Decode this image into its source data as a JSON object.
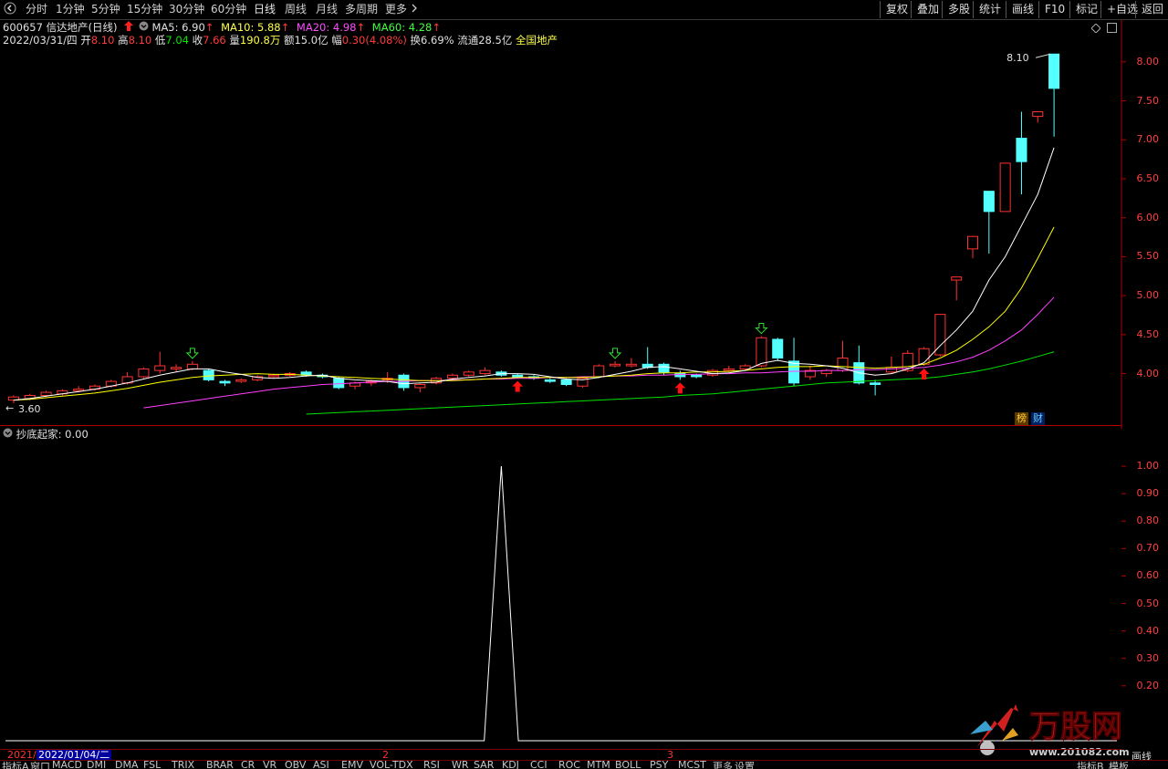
{
  "toolbar": {
    "back_icon": "chevron-left-icon",
    "periods": [
      "分时",
      "1分钟",
      "5分钟",
      "15分钟",
      "30分钟",
      "60分钟",
      "日线",
      "周线",
      "月线",
      "多周期",
      "更多"
    ],
    "active_period": "日线",
    "more_icon": "chevron-right-icon",
    "right_buttons": [
      "复权",
      "叠加",
      "多股",
      "统计",
      "画线",
      "F10",
      "标记",
      "+自选",
      "返回"
    ]
  },
  "stock": {
    "code": "600657",
    "name": "信达地产",
    "period": "(日线)",
    "ma5_label": "MA5: 6.90",
    "ma10_label": "MA10: 5.88",
    "ma20_label": "MA20: 4.98",
    "ma60_label": "MA60: 4.28",
    "arrow": "↑"
  },
  "quote": {
    "date": "2022/03/31/四",
    "open_lbl": "开",
    "open": "8.10",
    "high_lbl": "高",
    "high": "8.10",
    "low_lbl": "低",
    "low": "7.04",
    "close_lbl": "收",
    "close": "7.66",
    "vol_lbl": "量",
    "vol": "190.8万",
    "amount_lbl": "额",
    "amount": "15.0亿",
    "change_lbl": "幅",
    "change": "0.30(4.08%)",
    "turnover_lbl": "换",
    "turnover": "6.69%",
    "float_lbl": "流通",
    "float": "28.5亿",
    "sector": "全国地产"
  },
  "price_axis": [
    "8.00",
    "7.50",
    "7.00",
    "6.50",
    "6.00",
    "5.50",
    "5.00",
    "4.50",
    "4.00"
  ],
  "price_axis_values": [
    8.0,
    7.5,
    7.0,
    6.5,
    6.0,
    5.5,
    5.0,
    4.5,
    4.0
  ],
  "high_marker": "8.10",
  "low_marker": "3.60",
  "badges": {
    "bang": "榜",
    "cai": "财"
  },
  "indicator": {
    "name": "抄底起家",
    "value": ": 0.00",
    "axis": [
      "1.00",
      "0.90",
      "0.80",
      "0.70",
      "0.60",
      "0.50",
      "0.40",
      "0.30",
      "0.20"
    ]
  },
  "dates": {
    "start": "2021/",
    "selected": "2022/01/04/二",
    "m2": "2",
    "m3": "3"
  },
  "bottom_tabs": [
    "指标A",
    "窗口",
    "MACD",
    "DMI",
    "DMA",
    "FSL",
    "TRIX",
    "BRAR",
    "CR",
    "VR",
    "OBV",
    "ASI",
    "EMV",
    "VOL-TDX",
    "RSI",
    "WR",
    "SAR",
    "KDJ",
    "CCI",
    "ROC",
    "MTM",
    "BOLL",
    "PSY",
    "MCST",
    "更多",
    "设置"
  ],
  "bottom_right": [
    "指标B",
    "模板"
  ],
  "corner_label": "画线",
  "watermark": {
    "brand": "万股网",
    "url": "www.201082.com"
  },
  "colors": {
    "up": "#ff3232",
    "down": "#54ffff",
    "ma5": "#ffffff",
    "ma10": "#ffff00",
    "ma20": "#ff40ff",
    "ma60": "#00e000",
    "axis": "#b00000"
  },
  "chart_data": {
    "type": "candlestick",
    "candles": [
      {
        "o": 3.66,
        "c": 3.7,
        "h": 3.72,
        "l": 3.62
      },
      {
        "o": 3.68,
        "c": 3.72,
        "h": 3.74,
        "l": 3.66
      },
      {
        "o": 3.72,
        "c": 3.76,
        "h": 3.78,
        "l": 3.7
      },
      {
        "o": 3.74,
        "c": 3.78,
        "h": 3.8,
        "l": 3.72
      },
      {
        "o": 3.78,
        "c": 3.8,
        "h": 3.84,
        "l": 3.76
      },
      {
        "o": 3.8,
        "c": 3.84,
        "h": 3.86,
        "l": 3.78
      },
      {
        "o": 3.84,
        "c": 3.9,
        "h": 3.92,
        "l": 3.82
      },
      {
        "o": 3.88,
        "c": 3.96,
        "h": 4.02,
        "l": 3.86
      },
      {
        "o": 3.96,
        "c": 4.06,
        "h": 4.08,
        "l": 3.94
      },
      {
        "o": 4.04,
        "c": 4.1,
        "h": 4.28,
        "l": 4.0
      },
      {
        "o": 4.06,
        "c": 4.08,
        "h": 4.12,
        "l": 4.02
      },
      {
        "o": 4.06,
        "c": 4.12,
        "h": 4.16,
        "l": 4.04
      },
      {
        "o": 4.04,
        "c": 3.92,
        "h": 4.06,
        "l": 3.9
      },
      {
        "o": 3.9,
        "c": 3.88,
        "h": 3.92,
        "l": 3.84
      },
      {
        "o": 3.9,
        "c": 3.92,
        "h": 3.94,
        "l": 3.88
      },
      {
        "o": 3.92,
        "c": 3.96,
        "h": 3.98,
        "l": 3.9
      },
      {
        "o": 3.96,
        "c": 3.98,
        "h": 4.0,
        "l": 3.94
      },
      {
        "o": 3.98,
        "c": 4.0,
        "h": 4.02,
        "l": 3.96
      },
      {
        "o": 4.02,
        "c": 3.98,
        "h": 4.04,
        "l": 3.96
      },
      {
        "o": 3.98,
        "c": 3.96,
        "h": 4.0,
        "l": 3.94
      },
      {
        "o": 3.94,
        "c": 3.82,
        "h": 3.96,
        "l": 3.8
      },
      {
        "o": 3.84,
        "c": 3.88,
        "h": 3.9,
        "l": 3.8
      },
      {
        "o": 3.88,
        "c": 3.9,
        "h": 3.92,
        "l": 3.84
      },
      {
        "o": 3.92,
        "c": 3.94,
        "h": 4.02,
        "l": 3.88
      },
      {
        "o": 3.98,
        "c": 3.82,
        "h": 4.0,
        "l": 3.78
      },
      {
        "o": 3.82,
        "c": 3.86,
        "h": 3.88,
        "l": 3.76
      },
      {
        "o": 3.88,
        "c": 3.94,
        "h": 3.96,
        "l": 3.86
      },
      {
        "o": 3.94,
        "c": 3.98,
        "h": 4.0,
        "l": 3.92
      },
      {
        "o": 3.98,
        "c": 4.02,
        "h": 4.04,
        "l": 3.96
      },
      {
        "o": 4.0,
        "c": 4.04,
        "h": 4.08,
        "l": 3.98
      },
      {
        "o": 4.02,
        "c": 3.98,
        "h": 4.04,
        "l": 3.96
      },
      {
        "o": 3.98,
        "c": 3.96,
        "h": 4.0,
        "l": 3.94
      },
      {
        "o": 3.96,
        "c": 3.94,
        "h": 3.98,
        "l": 3.92
      },
      {
        "o": 3.92,
        "c": 3.9,
        "h": 3.94,
        "l": 3.88
      },
      {
        "o": 3.92,
        "c": 3.86,
        "h": 3.94,
        "l": 3.84
      },
      {
        "o": 3.84,
        "c": 3.94,
        "h": 3.96,
        "l": 3.82
      },
      {
        "o": 3.96,
        "c": 4.1,
        "h": 4.12,
        "l": 3.94
      },
      {
        "o": 4.1,
        "c": 4.12,
        "h": 4.16,
        "l": 4.08
      },
      {
        "o": 4.1,
        "c": 4.12,
        "h": 4.2,
        "l": 4.08
      },
      {
        "o": 4.12,
        "c": 4.08,
        "h": 4.34,
        "l": 4.06
      },
      {
        "o": 4.12,
        "c": 4.02,
        "h": 4.14,
        "l": 3.98
      },
      {
        "o": 4.0,
        "c": 3.96,
        "h": 4.04,
        "l": 3.92
      },
      {
        "o": 3.98,
        "c": 3.96,
        "h": 4.0,
        "l": 3.94
      },
      {
        "o": 3.98,
        "c": 4.04,
        "h": 4.06,
        "l": 3.96
      },
      {
        "o": 4.04,
        "c": 4.06,
        "h": 4.1,
        "l": 4.02
      },
      {
        "o": 4.06,
        "c": 4.1,
        "h": 4.12,
        "l": 4.04
      },
      {
        "o": 4.1,
        "c": 4.46,
        "h": 4.48,
        "l": 4.08
      },
      {
        "o": 4.44,
        "c": 4.2,
        "h": 4.46,
        "l": 4.16
      },
      {
        "o": 4.16,
        "c": 3.88,
        "h": 4.46,
        "l": 3.84
      },
      {
        "o": 3.96,
        "c": 4.04,
        "h": 4.1,
        "l": 3.92
      },
      {
        "o": 4.0,
        "c": 4.04,
        "h": 4.06,
        "l": 3.96
      },
      {
        "o": 4.04,
        "c": 4.2,
        "h": 4.42,
        "l": 4.02
      },
      {
        "o": 4.14,
        "c": 3.88,
        "h": 4.36,
        "l": 3.86
      },
      {
        "o": 3.88,
        "c": 3.86,
        "h": 3.92,
        "l": 3.72
      },
      {
        "o": 4.02,
        "c": 4.08,
        "h": 4.22,
        "l": 4.0
      },
      {
        "o": 4.04,
        "c": 4.26,
        "h": 4.3,
        "l": 4.02
      },
      {
        "o": 4.12,
        "c": 4.32,
        "h": 4.34,
        "l": 4.1
      },
      {
        "o": 4.24,
        "c": 4.76,
        "h": 4.76,
        "l": 4.22
      },
      {
        "o": 5.2,
        "c": 5.24,
        "h": 5.24,
        "l": 4.94
      },
      {
        "o": 5.6,
        "c": 5.76,
        "h": 5.76,
        "l": 5.48
      },
      {
        "o": 6.34,
        "c": 6.08,
        "h": 6.34,
        "l": 5.54
      },
      {
        "o": 6.08,
        "c": 6.7,
        "h": 6.7,
        "l": 6.08
      },
      {
        "o": 7.02,
        "c": 6.72,
        "h": 7.36,
        "l": 6.3
      },
      {
        "o": 7.3,
        "c": 7.36,
        "h": 7.36,
        "l": 7.22
      },
      {
        "o": 8.1,
        "c": 7.66,
        "h": 8.1,
        "l": 7.04
      }
    ],
    "ma5": [
      3.66,
      3.68,
      3.71,
      3.74,
      3.77,
      3.8,
      3.84,
      3.88,
      3.93,
      3.98,
      4.02,
      4.06,
      4.06,
      4.02,
      3.99,
      3.95,
      3.94,
      3.95,
      3.97,
      3.98,
      3.94,
      3.92,
      3.91,
      3.9,
      3.87,
      3.88,
      3.89,
      3.93,
      3.95,
      3.97,
      4.0,
      4.0,
      3.99,
      3.96,
      3.93,
      3.92,
      3.95,
      3.99,
      4.03,
      4.08,
      4.09,
      4.06,
      4.03,
      4.0,
      4.01,
      4.04,
      4.13,
      4.17,
      4.13,
      4.12,
      4.1,
      4.07,
      4.01,
      3.98,
      4.0,
      4.06,
      4.14,
      4.36,
      4.56,
      4.8,
      5.2,
      5.5,
      5.9,
      6.3,
      6.9
    ],
    "ma10": [
      3.66,
      3.67,
      3.69,
      3.71,
      3.73,
      3.75,
      3.78,
      3.81,
      3.85,
      3.89,
      3.92,
      3.95,
      3.97,
      3.98,
      3.99,
      4.0,
      3.99,
      3.99,
      3.98,
      3.97,
      3.96,
      3.95,
      3.94,
      3.93,
      3.92,
      3.91,
      3.91,
      3.91,
      3.92,
      3.93,
      3.94,
      3.95,
      3.95,
      3.95,
      3.95,
      3.95,
      3.96,
      3.97,
      3.98,
      4.0,
      4.01,
      4.01,
      4.02,
      4.02,
      4.03,
      4.04,
      4.06,
      4.08,
      4.09,
      4.09,
      4.1,
      4.09,
      4.08,
      4.07,
      4.08,
      4.09,
      4.12,
      4.2,
      4.3,
      4.44,
      4.6,
      4.8,
      5.1,
      5.48,
      5.88
    ],
    "ma20": [
      null,
      null,
      null,
      null,
      null,
      null,
      null,
      null,
      3.56,
      3.59,
      3.62,
      3.65,
      3.68,
      3.71,
      3.74,
      3.77,
      3.8,
      3.82,
      3.84,
      3.86,
      3.87,
      3.88,
      3.89,
      3.9,
      3.9,
      3.91,
      3.91,
      3.92,
      3.92,
      3.93,
      3.93,
      3.94,
      3.94,
      3.95,
      3.95,
      3.96,
      3.96,
      3.97,
      3.97,
      3.98,
      3.98,
      3.99,
      3.99,
      4.0,
      4.0,
      4.01,
      4.01,
      4.02,
      4.03,
      4.03,
      4.04,
      4.04,
      4.05,
      4.05,
      4.06,
      4.07,
      4.08,
      4.11,
      4.15,
      4.21,
      4.3,
      4.42,
      4.56,
      4.76,
      4.98
    ],
    "ma60": [
      null,
      null,
      null,
      null,
      null,
      null,
      null,
      null,
      null,
      null,
      null,
      null,
      null,
      null,
      null,
      null,
      null,
      null,
      3.48,
      3.49,
      3.5,
      3.51,
      3.52,
      3.53,
      3.54,
      3.55,
      3.56,
      3.57,
      3.58,
      3.59,
      3.6,
      3.61,
      3.62,
      3.63,
      3.64,
      3.65,
      3.66,
      3.67,
      3.68,
      3.69,
      3.7,
      3.72,
      3.73,
      3.74,
      3.76,
      3.78,
      3.8,
      3.82,
      3.84,
      3.86,
      3.88,
      3.89,
      3.9,
      3.91,
      3.92,
      3.93,
      3.94,
      3.96,
      3.99,
      4.02,
      4.06,
      4.11,
      4.16,
      4.22,
      4.28
    ],
    "buy_signals": [
      31,
      41,
      56
    ],
    "sell_signals": [
      11,
      37,
      46
    ],
    "price_range": [
      3.55,
      8.15
    ],
    "indicator_series": {
      "name": "抄底起家",
      "range": [
        0,
        1.08
      ],
      "peak_index": 30,
      "peak_value": 1.0,
      "baseline": 0
    }
  }
}
